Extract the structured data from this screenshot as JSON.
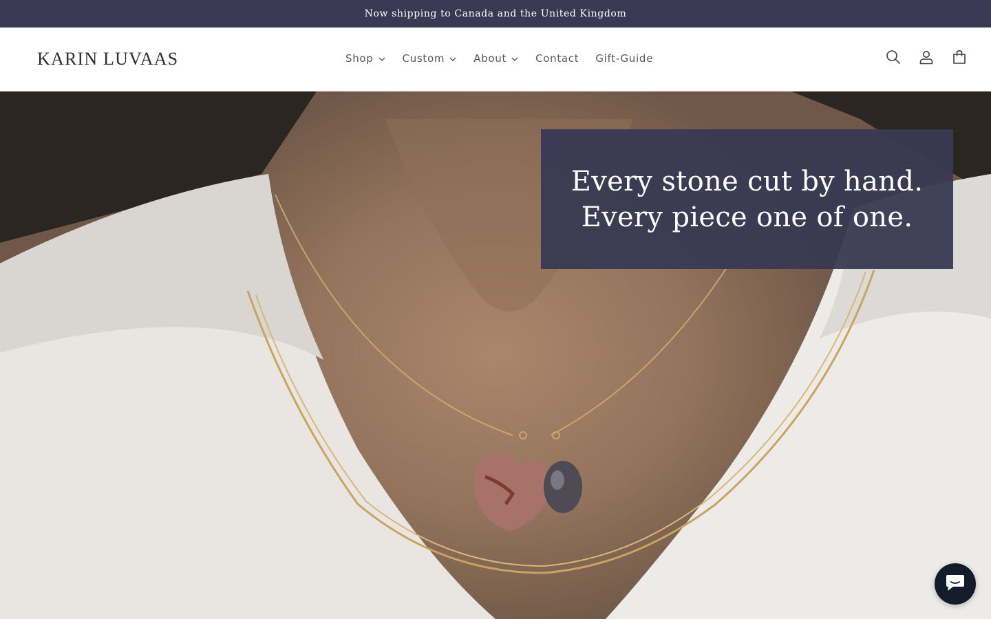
{
  "announcement": {
    "text": "Now shipping to Canada and the United Kingdom"
  },
  "header": {
    "logo": "KARIN LUVAAS",
    "nav": [
      {
        "label": "Shop",
        "has_dropdown": true
      },
      {
        "label": "Custom",
        "has_dropdown": true
      },
      {
        "label": "About",
        "has_dropdown": true
      },
      {
        "label": "Contact",
        "has_dropdown": false
      },
      {
        "label": "Gift-Guide",
        "has_dropdown": false
      }
    ],
    "icons": [
      "search-icon",
      "account-icon",
      "cart-icon"
    ]
  },
  "hero": {
    "line1": "Every stone cut by hand.",
    "line2": "Every piece one of one.",
    "image_icon": "necklace-photo"
  },
  "chat": {
    "icon": "chat-bubble-icon"
  },
  "colors": {
    "brand": "#393953",
    "text": "#3a3a4c",
    "chat_button": "#131c2c",
    "background": "#ffffff"
  }
}
